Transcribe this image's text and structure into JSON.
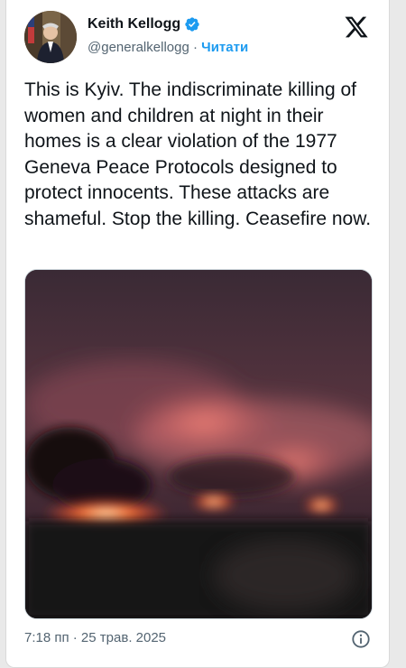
{
  "tweet": {
    "author_name": "Keith Kellogg",
    "handle": "@generalkellogg",
    "separator": "·",
    "follow_label": "Читати",
    "text": "This is Kyiv. The indiscriminate killing of women and children at night in their homes is a clear violation of the 1977 Geneva Peace Protocols designed to protect innocents. These attacks are shameful. Stop the killing. Ceasefire now.",
    "timestamp": "7:18 пп · 25 трав. 2025"
  },
  "icons": {
    "verified": "verified-badge-icon",
    "brand": "x-logo-icon",
    "info": "info-icon"
  },
  "colors": {
    "text": "#0f1419",
    "secondary": "#536471",
    "accent": "#1d9bf0"
  }
}
